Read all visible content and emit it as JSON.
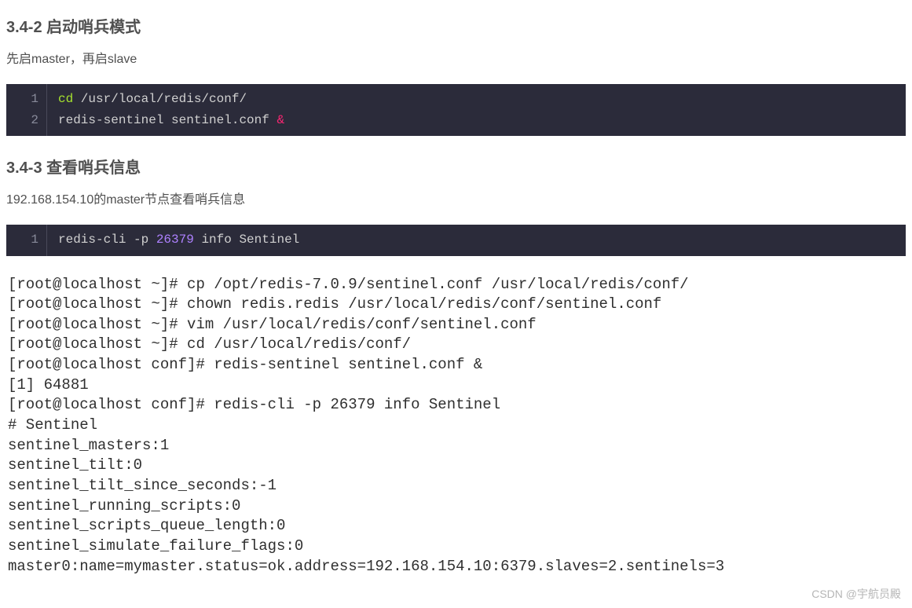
{
  "section1": {
    "heading": "3.4-2 启动哨兵模式",
    "desc": "先启master，再启slave",
    "code": {
      "lineNumbers": [
        "1",
        "2"
      ],
      "line1": {
        "cmd": "cd",
        "rest": " /usr/local/redis/conf/"
      },
      "line2": {
        "prefix": "redis-sentinel sentinel.conf ",
        "amp": "&"
      }
    }
  },
  "section2": {
    "heading": "3.4-3 查看哨兵信息",
    "desc": "192.168.154.10的master节点查看哨兵信息",
    "code": {
      "lineNumbers": [
        "1"
      ],
      "line1": {
        "prefix": "redis-cli -p ",
        "num": "26379",
        "suffix": " info Sentinel"
      }
    }
  },
  "terminal": {
    "lines": [
      "[root@localhost ~]# cp /opt/redis-7.0.9/sentinel.conf /usr/local/redis/conf/",
      "[root@localhost ~]# chown redis.redis /usr/local/redis/conf/sentinel.conf",
      "[root@localhost ~]# vim /usr/local/redis/conf/sentinel.conf",
      "[root@localhost ~]# cd /usr/local/redis/conf/",
      "[root@localhost conf]# redis-sentinel sentinel.conf &",
      "[1] 64881",
      "[root@localhost conf]# redis-cli -p 26379 info Sentinel",
      "# Sentinel",
      "sentinel_masters:1",
      "sentinel_tilt:0",
      "sentinel_tilt_since_seconds:-1",
      "sentinel_running_scripts:0",
      "sentinel_scripts_queue_length:0",
      "sentinel_simulate_failure_flags:0",
      "master0:name=mymaster.status=ok.address=192.168.154.10:6379.slaves=2.sentinels=3"
    ]
  },
  "watermark": "CSDN @宇航员殿"
}
